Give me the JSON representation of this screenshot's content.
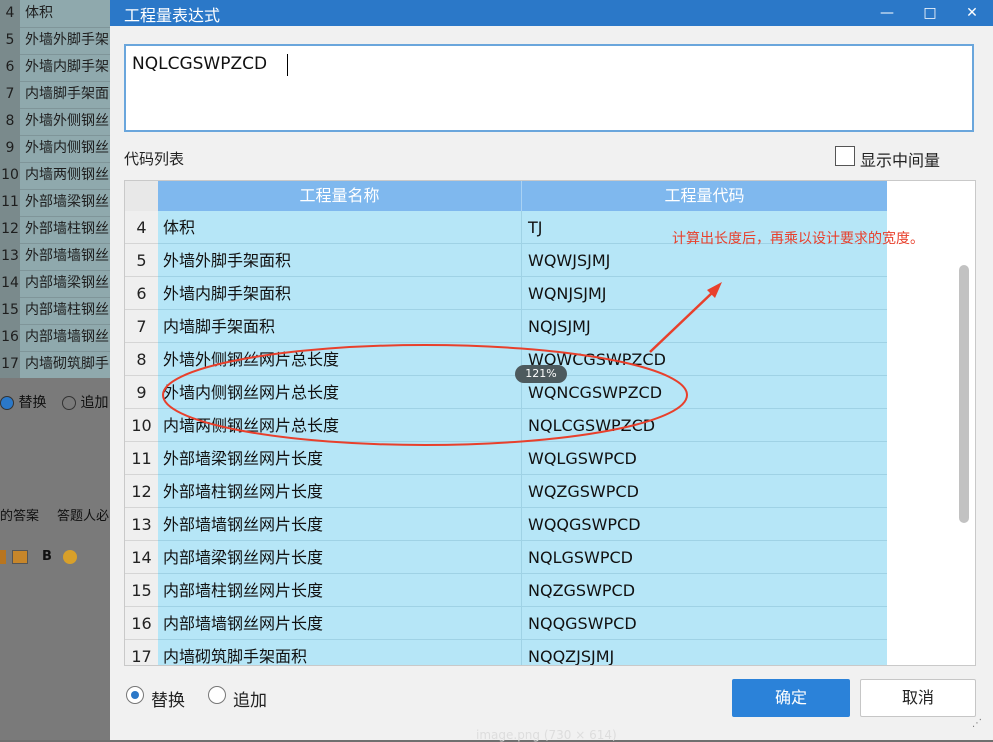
{
  "background": {
    "rows": [
      {
        "num": "4",
        "text": "体积"
      },
      {
        "num": "5",
        "text": "外墙外脚手架"
      },
      {
        "num": "6",
        "text": "外墙内脚手架"
      },
      {
        "num": "7",
        "text": "内墙脚手架面"
      },
      {
        "num": "8",
        "text": "外墙外侧钢丝"
      },
      {
        "num": "9",
        "text": "外墙内侧钢丝"
      },
      {
        "num": "10",
        "text": "内墙两侧钢丝"
      },
      {
        "num": "11",
        "text": "外部墙梁钢丝"
      },
      {
        "num": "12",
        "text": "外部墙柱钢丝"
      },
      {
        "num": "13",
        "text": "外部墙墙钢丝"
      },
      {
        "num": "14",
        "text": "内部墙梁钢丝"
      },
      {
        "num": "15",
        "text": "内部墙柱钢丝"
      },
      {
        "num": "16",
        "text": "内部墙墙钢丝"
      },
      {
        "num": "17",
        "text": "内墙砌筑脚手"
      }
    ],
    "radio_replace": "替换",
    "radio_append": "追加",
    "link_answer": "的答案",
    "link_required": "答题人必",
    "tool_bold": "B"
  },
  "dialog": {
    "title": "工程量表达式",
    "minimize": "—",
    "maximize": "□",
    "close": "✕",
    "expression_value": "NQLCGSWPZCD",
    "code_list_label": "代码列表",
    "show_intermediate_label": "显示中间量",
    "show_intermediate_checked": false,
    "table": {
      "headers": [
        "工程量名称",
        "工程量代码"
      ],
      "rows": [
        {
          "num": "4",
          "name": "体积",
          "code": "TJ"
        },
        {
          "num": "5",
          "name": "外墙外脚手架面积",
          "code": "WQWJSJMJ"
        },
        {
          "num": "6",
          "name": "外墙内脚手架面积",
          "code": "WQNJSJMJ"
        },
        {
          "num": "7",
          "name": "内墙脚手架面积",
          "code": "NQJSJMJ"
        },
        {
          "num": "8",
          "name": "外墙外侧钢丝网片总长度",
          "code": "WQWCGSWPZCD"
        },
        {
          "num": "9",
          "name": "外墙内侧钢丝网片总长度",
          "code": "WQNCGSWPZCD"
        },
        {
          "num": "10",
          "name": "内墙两侧钢丝网片总长度",
          "code": "NQLCGSWPZCD"
        },
        {
          "num": "11",
          "name": "外部墙梁钢丝网片长度",
          "code": "WQLGSWPCD"
        },
        {
          "num": "12",
          "name": "外部墙柱钢丝网片长度",
          "code": "WQZGSWPCD"
        },
        {
          "num": "13",
          "name": "外部墙墙钢丝网片长度",
          "code": "WQQGSWPCD"
        },
        {
          "num": "14",
          "name": "内部墙梁钢丝网片长度",
          "code": "NQLGSWPCD"
        },
        {
          "num": "15",
          "name": "内部墙柱钢丝网片长度",
          "code": "NQZGSWPCD"
        },
        {
          "num": "16",
          "name": "内部墙墙钢丝网片长度",
          "code": "NQQGSWPCD"
        },
        {
          "num": "17",
          "name": "内墙砌筑脚手架面积",
          "code": "NQQZJSJMJ"
        }
      ]
    },
    "annotation": "计算出长度后，再乘以设计要求的宽度。",
    "zoom_badge": "121%",
    "radio_replace": "替换",
    "radio_append": "追加",
    "selected_mode": "替换",
    "ok_button": "确定",
    "cancel_button": "取消",
    "resize_grip": "⋰",
    "caption": "image.png (730 × 614)"
  },
  "colors": {
    "titlebar": "#2b78c8",
    "header": "#7fb8ee",
    "row": "#b6e6f7",
    "annotation": "#e8402c",
    "ok": "#2b82d9"
  }
}
